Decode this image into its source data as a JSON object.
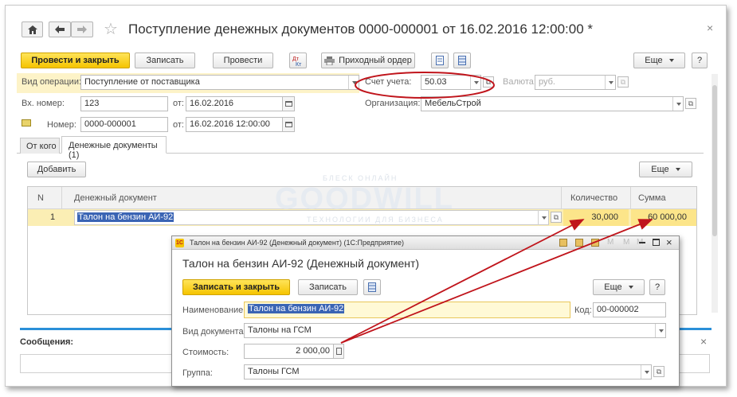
{
  "window": {
    "title": "Поступление денежных документов 0000-000001 от 16.02.2016 12:00:00 *"
  },
  "toolbar": {
    "post_close": "Провести и закрыть",
    "save": "Записать",
    "post": "Провести",
    "incoming_order": "Приходный ордер",
    "more": "Еще",
    "help": "?"
  },
  "form": {
    "operation_label": "Вид операции:",
    "operation_value": "Поступление от поставщика",
    "account_label": "Счет учета:",
    "account_value": "50.03",
    "currency_label": "Валюта:",
    "currency_value": "руб.",
    "in_number_label": "Вх. номер:",
    "in_number_value": "123",
    "from_label": "от:",
    "in_date_value": "16.02.2016",
    "org_label": "Организация:",
    "org_value": "МебельСтрой",
    "number_label": "Номер:",
    "number_value": "0000-000001",
    "date_value": "16.02.2016 12:00:00"
  },
  "tabs": [
    {
      "label": "От кого"
    },
    {
      "label": "Денежные документы (1)"
    }
  ],
  "table_toolbar": {
    "add": "Добавить",
    "more": "Еще"
  },
  "table": {
    "columns": [
      "N",
      "Денежный документ",
      "Количество",
      "Сумма"
    ],
    "rows": [
      {
        "n": "1",
        "document": "Талон на бензин АИ-92",
        "quantity": "30,000",
        "sum": "60 000,00"
      }
    ]
  },
  "watermark": {
    "top": "БЛЕСК ОНЛАЙН",
    "brand": "GOODWILL",
    "bottom": "ТЕХНОЛОГИИ ДЛЯ БИЗНЕСА"
  },
  "messages": {
    "label": "Сообщения:"
  },
  "dialog": {
    "window_title": "Талон на бензин АИ-92 (Денежный документ) (1С:Предприятие)",
    "title": "Талон на бензин АИ-92 (Денежный документ)",
    "save_close": "Записать и закрыть",
    "save": "Записать",
    "more": "Еще",
    "help": "?",
    "name_label": "Наименование:",
    "name_value": "Талон на бензин АИ-92",
    "code_label": "Код:",
    "code_value": "00-000002",
    "doctype_label": "Вид документа:",
    "doctype_value": "Талоны на ГСМ",
    "cost_label": "Стоимость:",
    "cost_value": "2 000,00",
    "group_label": "Группа:",
    "group_value": "Талоны ГСМ"
  },
  "colors": {
    "accent_yellow": "#f5c400",
    "row_highlight": "#fbeeb4",
    "selection": "#3a64b4",
    "annotation_red": "#c0141b",
    "messages_bar": "#2a8fd8"
  }
}
